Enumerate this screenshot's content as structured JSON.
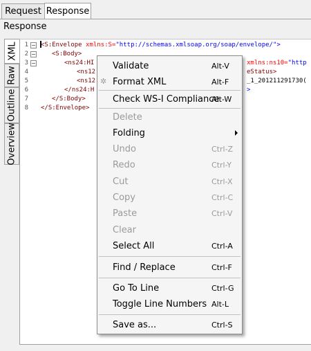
{
  "tabs": [
    {
      "label": "Request"
    },
    {
      "label": "Response"
    }
  ],
  "panel_label": "Response",
  "side_tabs": [
    "XML",
    "Raw",
    "Outline",
    "Overview"
  ],
  "editor": {
    "line_numbers": [
      "1",
      "2",
      "3",
      "4",
      "5",
      "6",
      "7",
      "8"
    ],
    "lines": {
      "l1": {
        "tag": "<S:Envelope ",
        "attr": "xmlns:S=",
        "val": "\"http://schemas.xmlsoap.org/soap/envelope/\"",
        "end": ">"
      },
      "l2": "<S:Body>",
      "l3": {
        "start": "<ns24:HI",
        "right_attr": "xmlns:ns10=",
        "right_val": "\"http"
      },
      "l4": {
        "start": "<ns12",
        "right": "eStatus>"
      },
      "l5": {
        "start": "<ns12",
        "right": "_1_201211291730("
      },
      "l6": {
        "start": "</ns24:H",
        "right": ">"
      },
      "l7": "</S:Body>",
      "l8": "</S:Envelope>"
    }
  },
  "context_menu": {
    "validate": {
      "label": "Validate",
      "shortcut": "Alt-V"
    },
    "format_xml": {
      "label": "Format XML",
      "shortcut": "Alt-F"
    },
    "check_wsi": {
      "label": "Check WS-I Compliance",
      "shortcut": "Alt-W"
    },
    "delete": {
      "label": "Delete"
    },
    "folding": {
      "label": "Folding"
    },
    "undo": {
      "label": "Undo",
      "shortcut": "Ctrl-Z"
    },
    "redo": {
      "label": "Redo",
      "shortcut": "Ctrl-Y"
    },
    "cut": {
      "label": "Cut",
      "shortcut": "Ctrl-X"
    },
    "copy": {
      "label": "Copy",
      "shortcut": "Ctrl-C"
    },
    "paste": {
      "label": "Paste",
      "shortcut": "Ctrl-V"
    },
    "clear": {
      "label": "Clear"
    },
    "select_all": {
      "label": "Select All",
      "shortcut": "Ctrl-A"
    },
    "find_replace": {
      "label": "Find / Replace",
      "shortcut": "Ctrl-F"
    },
    "go_to_line": {
      "label": "Go To Line",
      "shortcut": "Ctrl-G"
    },
    "toggle_line_numbers": {
      "label": "Toggle Line Numbers",
      "shortcut": "Alt-L"
    },
    "save_as": {
      "label": "Save as...",
      "shortcut": "Ctrl-S"
    }
  },
  "colors": {
    "tag": "#800000",
    "attribute": "#ff0000",
    "value": "#0000ff",
    "disabled": "#9a9a9a"
  }
}
